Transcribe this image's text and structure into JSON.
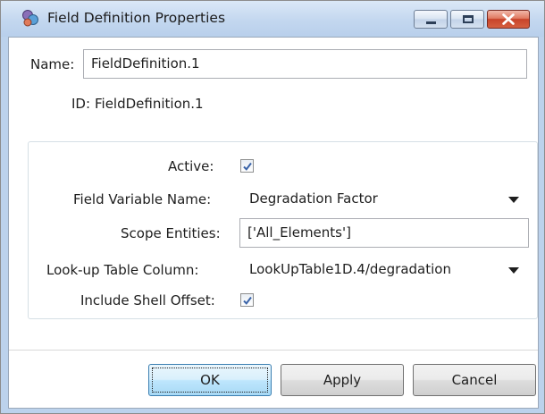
{
  "window": {
    "title": "Field Definition Properties",
    "icon": "field-definition-icon"
  },
  "form": {
    "name_label": "Name:",
    "name_value": "FieldDefinition.1",
    "id_label": "ID:",
    "id_value": "FieldDefinition.1"
  },
  "group": {
    "active_label": "Active:",
    "active_checked": true,
    "field_variable_label": "Field Variable Name:",
    "field_variable_value": "Degradation Factor",
    "scope_label": "Scope Entities:",
    "scope_value": "['All_Elements']",
    "lookup_label": "Look-up Table Column:",
    "lookup_value": "LookUpTable1D.4/degradation",
    "shell_offset_label": "Include Shell Offset:",
    "shell_offset_checked": true
  },
  "buttons": {
    "ok": "OK",
    "apply": "Apply",
    "cancel": "Cancel"
  },
  "colors": {
    "titlebar": "#c3d7ef",
    "close_button": "#c8432a",
    "checkmark": "#3a63a8",
    "default_button": "#bee6fd"
  }
}
